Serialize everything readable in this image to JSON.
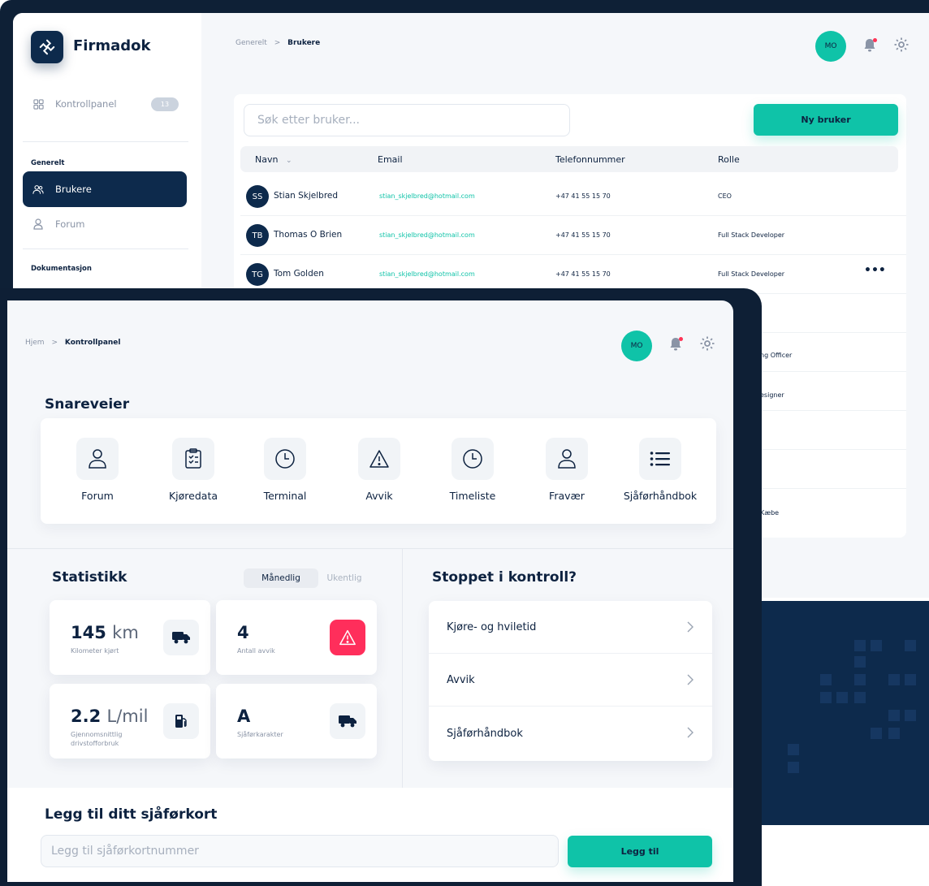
{
  "colors": {
    "navy": "#0d2a4c",
    "teal": "#0fc3a8",
    "alert_red": "#ff2e5b",
    "background": "#f5f7fa"
  },
  "back": {
    "app_name": "Firmadok",
    "sidebar": {
      "dashboard": {
        "label": "Kontrollpanel",
        "badge": "13",
        "icon": "grid-icon"
      },
      "section_general": "Generelt",
      "users": {
        "label": "Brukere",
        "icon": "users-icon"
      },
      "forum": {
        "label": "Forum",
        "icon": "user-icon"
      },
      "section_docs": "Dokumentasjon"
    },
    "breadcrumb": {
      "parent": "Generelt",
      "separator": ">",
      "current": "Brukere"
    },
    "avatar": "MO",
    "search_placeholder": "Søk etter bruker...",
    "new_user_button": "Ny bruker",
    "table": {
      "columns": [
        "Navn",
        "Email",
        "Telefonnummer",
        "Rolle"
      ],
      "sort_indicator": "⌄",
      "rows": [
        {
          "initials": "SS",
          "name": "Stian Skjelbred",
          "email": "stian_skjelbred@hotmail.com",
          "phone": "+47 41 55 15 70",
          "role": "CEO"
        },
        {
          "initials": "TB",
          "name": "Thomas O Brien",
          "email": "stian_skjelbred@hotmail.com",
          "phone": "+47 41 55 15 70",
          "role": "Full Stack Developer"
        },
        {
          "initials": "TG",
          "name": "Tom Golden",
          "email": "stian_skjelbred@hotmail.com",
          "phone": "+47 41 55 15 70",
          "role": "Full Stack Developer",
          "more": "•••"
        }
      ],
      "partial_roles": [
        "ng Officer",
        "esigner",
        "Kæbe"
      ]
    }
  },
  "front": {
    "breadcrumb": {
      "parent": "Hjem",
      "separator": ">",
      "current": "Kontrollpanel"
    },
    "avatar": "MO",
    "shortcuts_title": "Snareveier",
    "shortcuts": [
      {
        "label": "Forum",
        "icon": "user-icon"
      },
      {
        "label": "Kjøredata",
        "icon": "clipboard-icon"
      },
      {
        "label": "Terminal",
        "icon": "clock-icon"
      },
      {
        "label": "Avvik",
        "icon": "warning-icon"
      },
      {
        "label": "Timeliste",
        "icon": "clock-icon"
      },
      {
        "label": "Fravær",
        "icon": "user-icon"
      },
      {
        "label": "Sjåførhåndbok",
        "icon": "list-icon"
      }
    ],
    "stats_title": "Statistikk",
    "toggle": {
      "active": "Månedlig",
      "inactive": "Ukentlig"
    },
    "stats": {
      "km": {
        "value": "145",
        "unit": "km",
        "label": "Kilometer kjørt",
        "icon": "truck-icon"
      },
      "deviations": {
        "value": "4",
        "label": "Antall avvik",
        "icon": "warning-icon"
      },
      "fuel": {
        "value": "2.2",
        "unit": "L/mil",
        "label_line1": "Gjennomsnittlig",
        "label_line2": "drivstofforbruk",
        "icon": "fuel-pump-icon"
      },
      "grade": {
        "value": "A",
        "label": "Sjåførkarakter",
        "icon": "truck-icon"
      }
    },
    "kontroll_title": "Stoppet i kontroll?",
    "kontroll_items": [
      "Kjøre- og hviletid",
      "Avvik",
      "Sjåførhåndbok"
    ],
    "card_title": "Legg til ditt sjåførkort",
    "card_placeholder": "Legg til sjåførkortnummer",
    "card_button": "Legg til"
  }
}
